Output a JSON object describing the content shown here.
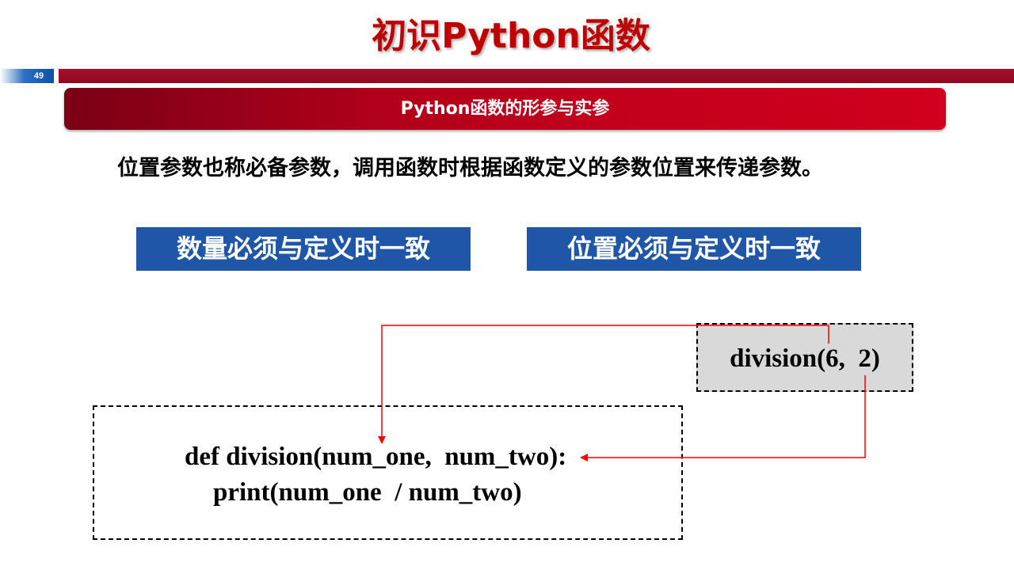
{
  "slide": {
    "title": "初识Python函数",
    "page_number": "49",
    "section_heading": "Python函数的形参与实参",
    "lead_text": "位置参数也称必备参数，调用函数时根据函数定义的参数位置来传递参数。"
  },
  "rules": {
    "count_rule": "数量必须与定义时一致",
    "position_rule": "位置必须与定义时一致"
  },
  "example": {
    "call": "division(6,  2)",
    "definition_line": "def division(num_one,  num_two):",
    "body_line": "print(num_one  / num_two)"
  },
  "colors": {
    "title_red": "#c00000",
    "banner_red": "#c4001c",
    "rule_blue": "#1f56a8",
    "arrow_red": "#ff0000",
    "call_box_gray": "#d9d9d9"
  }
}
